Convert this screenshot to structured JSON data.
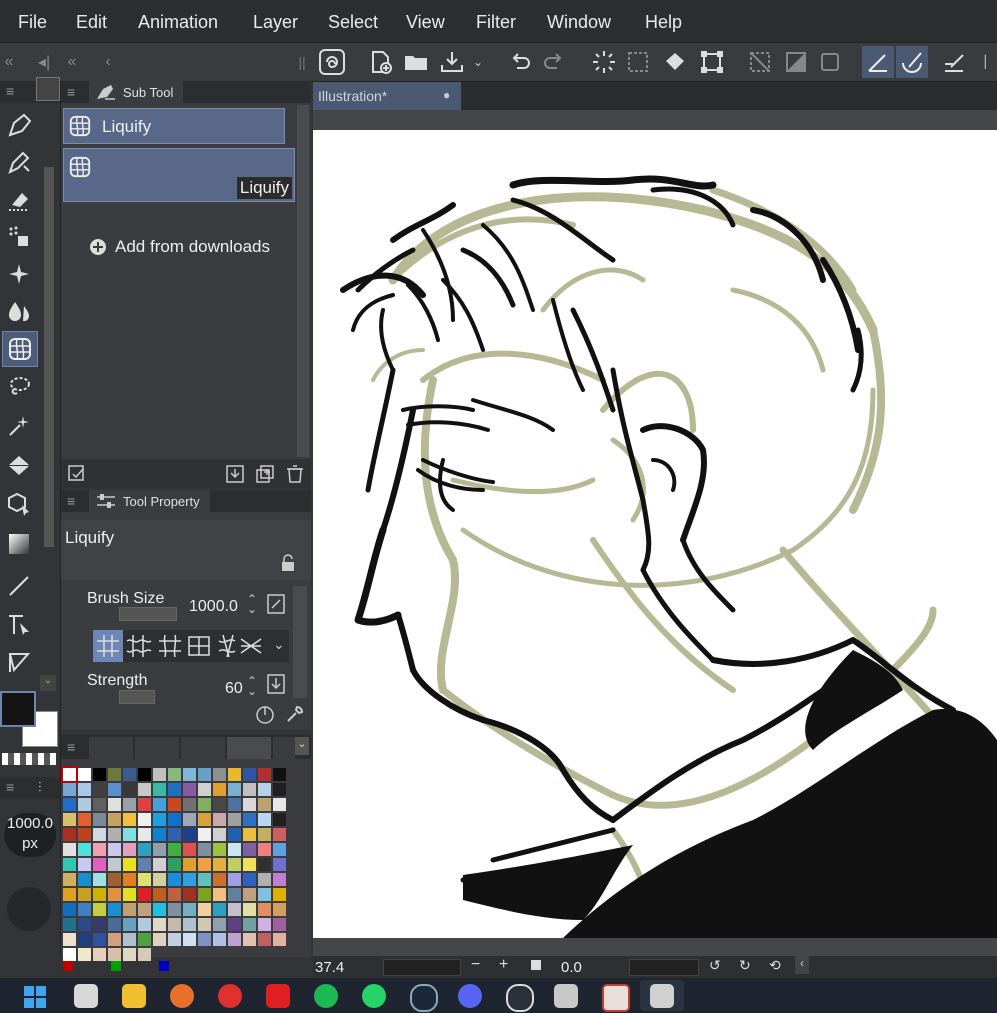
{
  "menu": [
    "File",
    "Edit",
    "Animation",
    "Layer",
    "Select",
    "View",
    "Filter",
    "Window",
    "Help"
  ],
  "document_tab": "Illustration*",
  "subtool": {
    "tab_label": "Sub Tool",
    "group_label": "Liquify",
    "item_label": "Liquify",
    "add_label": "Add from downloads"
  },
  "tool_property": {
    "tab_label": "Tool Property",
    "tool_name": "Liquify",
    "brush_size_label": "Brush Size",
    "brush_size_value": "1000.0",
    "strength_label": "Strength",
    "strength_value": "60"
  },
  "brush_size_indicator": {
    "value": "1000.0",
    "unit": "px"
  },
  "status": {
    "zoom": "37.4",
    "rotation": "0.0"
  },
  "colors": {
    "accent": "#4d5d79",
    "main_color": "#141414",
    "sub_color": "#ffffff",
    "sketch_color": "#b7b894",
    "ink_color": "#111111"
  },
  "palette": [
    "#ffffff",
    "#ffffff",
    "#000000",
    "#6b7a3a",
    "#3a5b8c",
    "#000000",
    "#c0c0c0",
    "#87b87c",
    "#7fb7d8",
    "#6aa0c8",
    "#8f8f8f",
    "#e8b830",
    "#3054a0",
    "#b03030",
    "#111111",
    "#7aa5d6",
    "#a8c8e8",
    "#404040",
    "#5a8fd0",
    "#383838",
    "#c8c8c8",
    "#3cb8a8",
    "#2070c0",
    "#8c5aa0",
    "#d0d0d0",
    "#e0a030",
    "#7ab0d0",
    "#c0c0c0",
    "#b8d0e8",
    "#202020",
    "#1e6ec8",
    "#b0c8e0",
    "#606060",
    "#e0e0e0",
    "#9aa0a8",
    "#e04040",
    "#48a0d8",
    "#c84820",
    "#707070",
    "#80b060",
    "#484848",
    "#5070a0",
    "#d8d8d8",
    "#c0a070",
    "#e8e8e8",
    "#d8c070",
    "#e06030",
    "#7a8a9a",
    "#c8a060",
    "#f0c040",
    "#f0f0f0",
    "#20a0e0",
    "#1070d0",
    "#9aa8b8",
    "#d8a040",
    "#c8a8a8",
    "#a0a0a0",
    "#3070c0",
    "#b8d8f0",
    "#202020",
    "#a83020",
    "#c04020",
    "#d0d8e0",
    "#b0b0b0",
    "#80e0e0",
    "#e8e8e8",
    "#1080d0",
    "#3060b0",
    "#1e3f8c",
    "#f0f0f0",
    "#d0d0d0",
    "#2060b0",
    "#e8c040",
    "#c0b060",
    "#d06060",
    "#e0e0e0",
    "#50e0e0",
    "#f0a0b0",
    "#c8c8f0",
    "#e0a0c0",
    "#30a0c0",
    "#90a0b0",
    "#40b040",
    "#e05050",
    "#8090a0",
    "#a0c040",
    "#c8e8f0",
    "#8060a0",
    "#f08080",
    "#60a0e0",
    "#30c8b0",
    "#c8c8f0",
    "#e060c0",
    "#c0c8d0",
    "#e8e020",
    "#6080b0",
    "#d0d0d0",
    "#30a060",
    "#e0a030",
    "#f0a040",
    "#e0b040",
    "#c0d060",
    "#f0e060",
    "#303030",
    "#7070d0",
    "#d0b060",
    "#1890d0",
    "#a0e0e0",
    "#a06030",
    "#e08020",
    "#e0e070",
    "#d0d0a0",
    "#1890e0",
    "#30a0e0",
    "#60c0c0",
    "#d07030",
    "#a0a0e0",
    "#3060c0",
    "#b0b0b0",
    "#c080d0",
    "#e0a020",
    "#c8a020",
    "#d0b000",
    "#e09040",
    "#e0e020",
    "#e02020",
    "#c06020",
    "#c06040",
    "#a03020",
    "#80a020",
    "#f0c080",
    "#6080a0",
    "#c0a080",
    "#80c0e0",
    "#e0b000",
    "#1070c0",
    "#4080c0",
    "#c0d040",
    "#1890d0",
    "#c0a070",
    "#c0a080",
    "#20c0e0",
    "#8090a0",
    "#70b0c0",
    "#f0d0a0",
    "#30a0c0",
    "#c0c0d0",
    "#e0e0a0",
    "#e09060",
    "#d0a060",
    "#207090",
    "#2a4a8a",
    "#3a3a6a",
    "#4a6a9a",
    "#6aa0c0",
    "#b0c8e0",
    "#e0d8c8",
    "#c8b8a8",
    "#b0c0d0",
    "#d0c8b0",
    "#90a0b0",
    "#604080",
    "#70a0a0",
    "#d0b0e0",
    "#a060a0",
    "#f0e0d0",
    "#1f3f7f",
    "#3050a0",
    "#d0a080",
    "#b0c0d0",
    "#50a040",
    "#e0d0c0",
    "#c0d0e0",
    "#d0e0f0",
    "#8090c0",
    "#b0c0e0",
    "#c0a0d0",
    "#e0c0b0",
    "#c06060",
    "#e0b0a0",
    "#ffffff",
    "#f0e8c8",
    "#e8d0b8",
    "#d8c0a8",
    "#e0d8c0",
    "#d8c8b8"
  ],
  "rgb_markers": [
    "#c00000",
    "#00a000",
    "#0000c0"
  ]
}
